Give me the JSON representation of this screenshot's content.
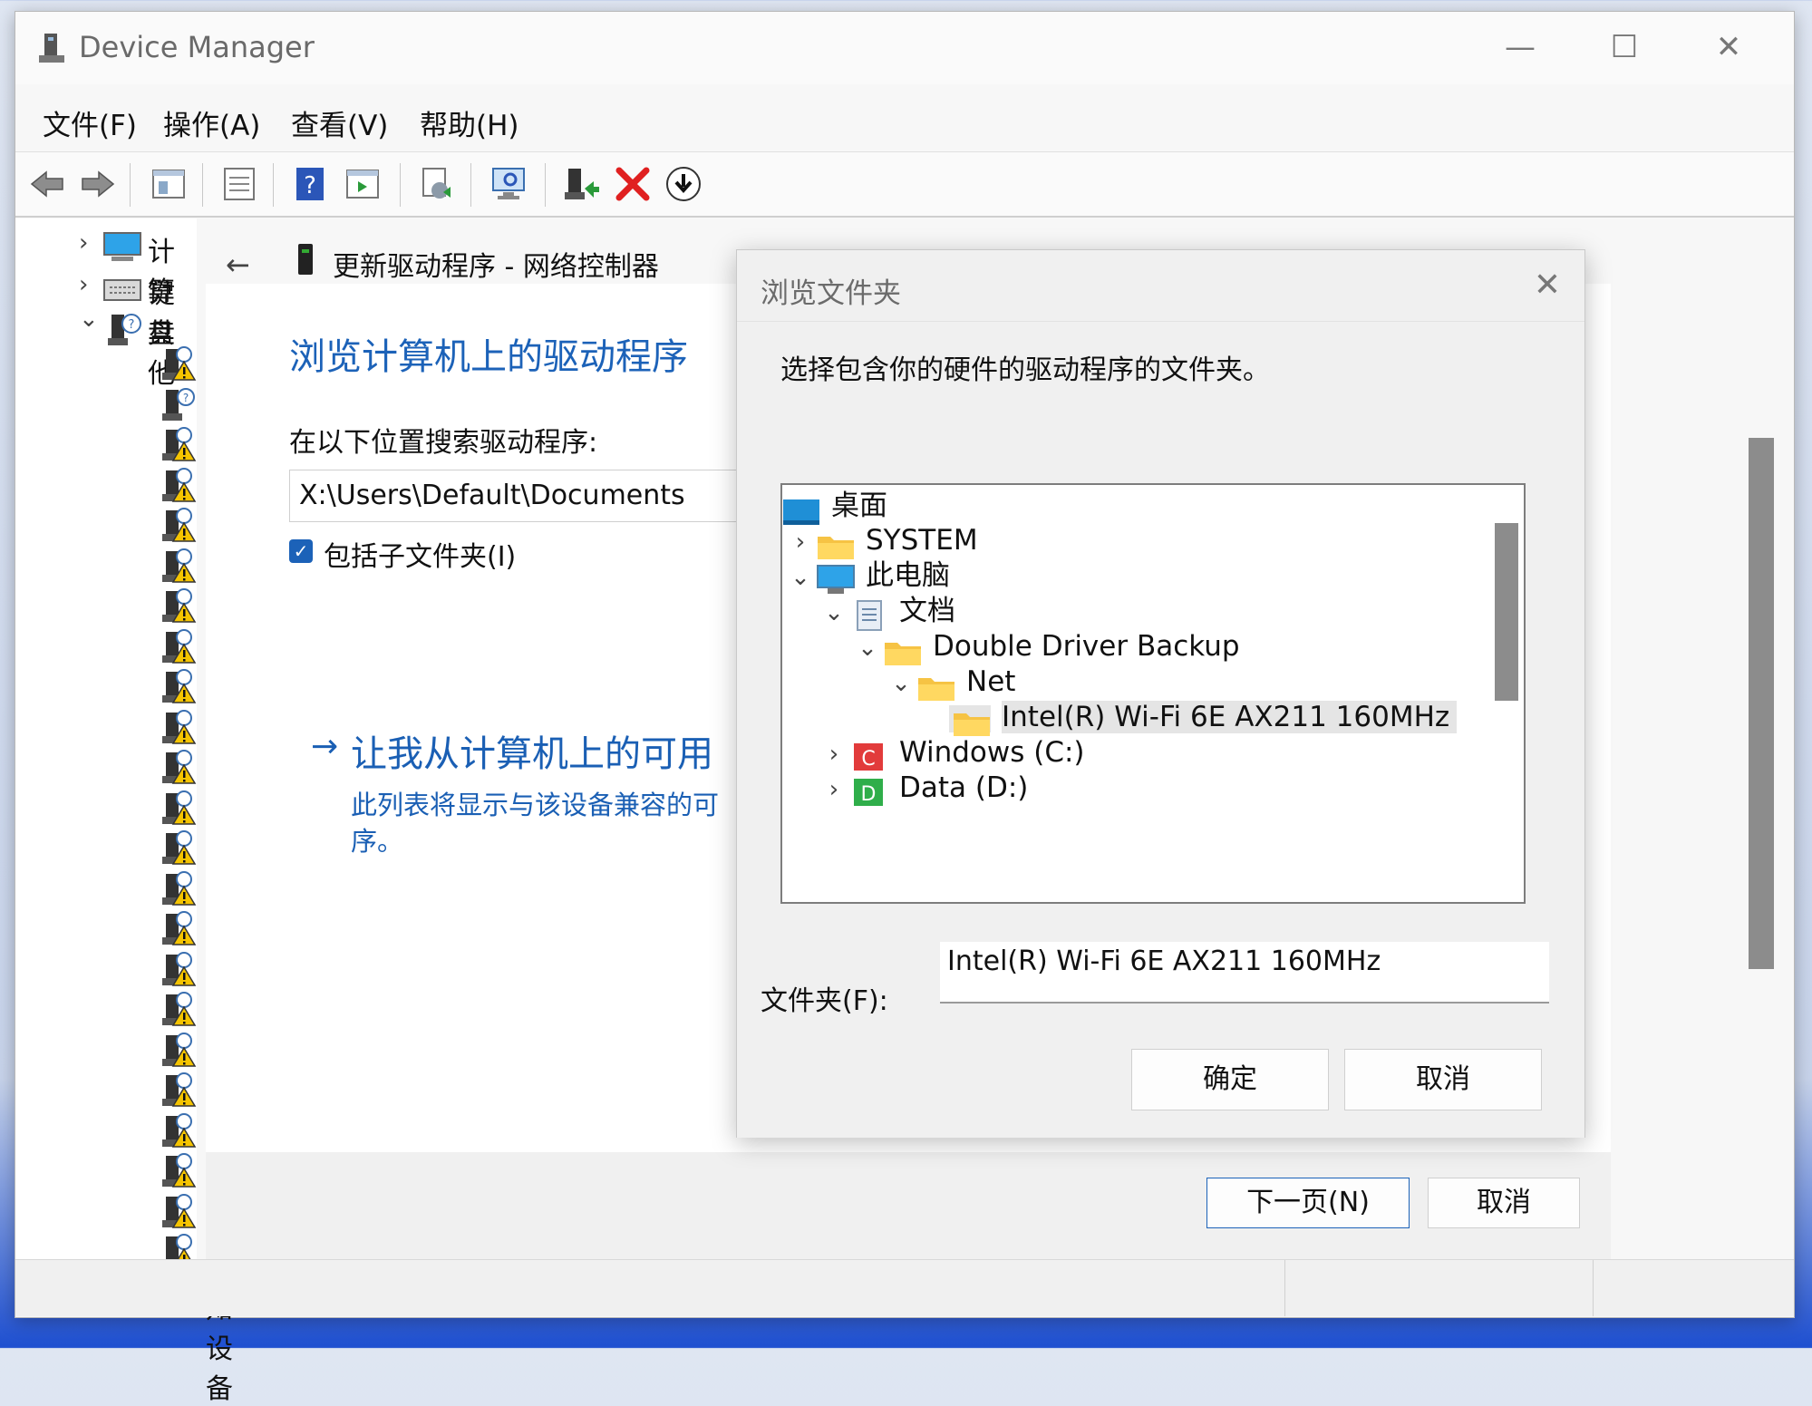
{
  "window": {
    "title": "Device Manager",
    "minimize_glyph": "—",
    "maximize_glyph": "☐",
    "close_glyph": "✕"
  },
  "menu": [
    "文件(F)",
    "操作(A)",
    "查看(V)",
    "帮助(H)"
  ],
  "toolbar_icons": [
    "back-arrow-icon",
    "forward-arrow-icon",
    "properties-icon",
    "list-view-icon",
    "help-icon",
    "console-tree-icon",
    "update-driver-icon",
    "scan-hardware-icon",
    "enable-device-icon",
    "uninstall-icon",
    "download-icon"
  ],
  "tree": {
    "items": [
      {
        "label": "计算",
        "icon": "computer-icon",
        "chevron": "›"
      },
      {
        "label": "键盘",
        "icon": "keyboard-icon",
        "chevron": "›"
      },
      {
        "label": "其他",
        "icon": "other-devices-icon",
        "chevron": "⌄"
      }
    ],
    "unknown_label": "未知设备"
  },
  "wizard": {
    "back_glyph": "←",
    "header": "更新驱动程序 - 网络控制器",
    "title": "浏览计算机上的驱动程序",
    "search_label": "在以下位置搜索驱动程序:",
    "path_value": "X:\\Users\\Default\\Documents",
    "include_subfolders": "包括子文件夹(I)",
    "link_arrow": "→",
    "link_text": "让我从计算机上的可用",
    "link_desc_1": "此列表将显示与该设备兼容的可",
    "link_desc_2": "序。",
    "next_button": "下一页(N)",
    "cancel_button": "取消"
  },
  "dialog": {
    "title": "浏览文件夹",
    "close_glyph": "✕",
    "prompt": "选择包含你的硬件的驱动程序的文件夹。",
    "tree": [
      {
        "label": "桌面",
        "indent": 0,
        "chevron": "",
        "icon": "desktop-icon"
      },
      {
        "label": "SYSTEM",
        "indent": 0,
        "chevron": "›",
        "icon": "folder-icon"
      },
      {
        "label": "此电脑",
        "indent": 0,
        "chevron": "⌄",
        "icon": "this-pc-icon"
      },
      {
        "label": "文档",
        "indent": 1,
        "chevron": "⌄",
        "icon": "documents-icon"
      },
      {
        "label": "Double Driver Backup",
        "indent": 2,
        "chevron": "⌄",
        "icon": "folder-icon"
      },
      {
        "label": "Net",
        "indent": 3,
        "chevron": "⌄",
        "icon": "folder-icon"
      },
      {
        "label": "Intel(R) Wi-Fi 6E AX211 160MHz",
        "indent": 4,
        "chevron": "",
        "icon": "folder-icon",
        "selected": true
      },
      {
        "label": "Windows (C:)",
        "indent": 1,
        "chevron": "›",
        "icon": "drive-c-icon"
      },
      {
        "label": "Data (D:)",
        "indent": 1,
        "chevron": "›",
        "icon": "drive-d-icon"
      }
    ],
    "folder_label": "文件夹(F):",
    "folder_value": "Intel(R) Wi-Fi 6E AX211 160MHz",
    "ok_button": "确定",
    "cancel_button": "取消"
  },
  "colors": {
    "accent_blue": "#1c62b8",
    "link_blue": "#1a5fb4",
    "folder_yellow": "#f6c344",
    "warning_yellow": "#f5c400",
    "uninstall_red": "#e02020",
    "selection_gray": "#e5e5e5"
  }
}
